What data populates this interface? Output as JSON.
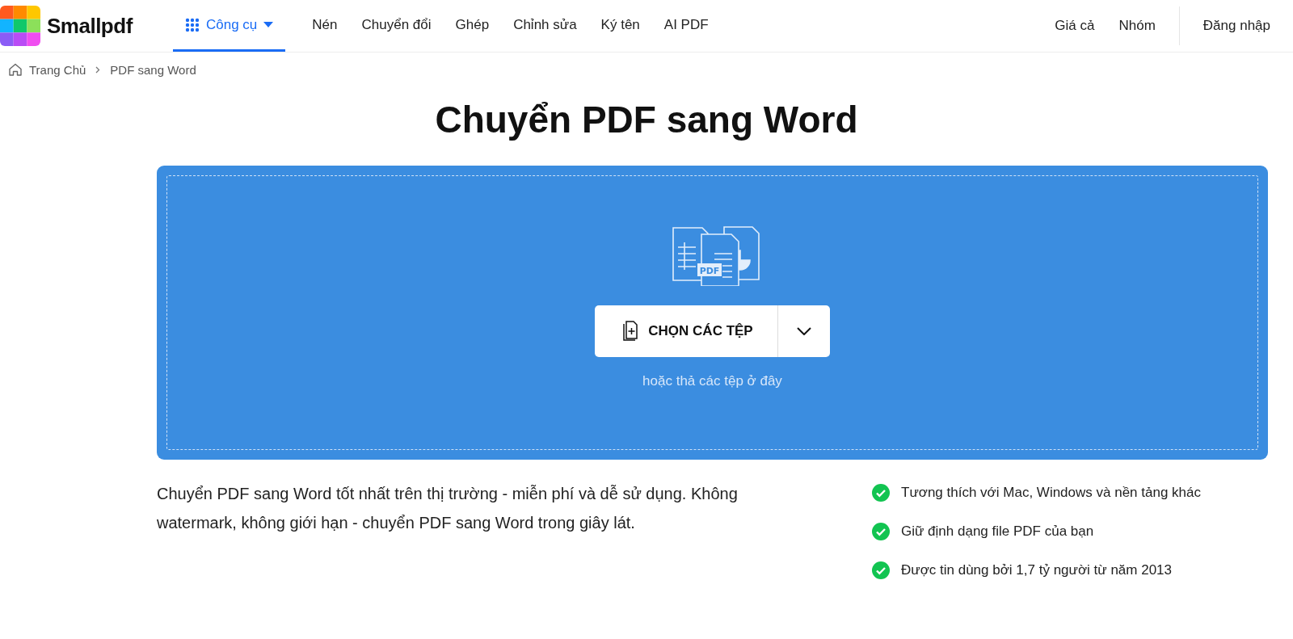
{
  "header": {
    "logo": "Smallpdf",
    "nav": [
      {
        "label": "Công cụ",
        "selected": true,
        "kind": "menu"
      },
      {
        "label": "Nén",
        "selected": false,
        "kind": "link"
      },
      {
        "label": "Chuyển đổi",
        "selected": false,
        "kind": "link"
      },
      {
        "label": "Ghép",
        "selected": false,
        "kind": "link"
      },
      {
        "label": "Chỉnh sửa",
        "selected": false,
        "kind": "link"
      },
      {
        "label": "Ký tên",
        "selected": false,
        "kind": "link"
      },
      {
        "label": "AI PDF",
        "selected": false,
        "kind": "link"
      }
    ],
    "right_links": [
      "Giá cả",
      "Nhóm"
    ],
    "login": "Đăng nhập"
  },
  "breadcrumb": [
    "Trang Chủ",
    "PDF sang Word"
  ],
  "title": "Chuyển PDF sang Word",
  "dropzone": {
    "illustration_label": "PDF",
    "button": "CHỌN CÁC TỆP",
    "hint": "hoặc thả các tệp ở đây"
  },
  "description": "Chuyển PDF sang Word tốt nhất trên thị trường - miễn phí và dễ sử dụng. Không watermark, không giới hạn - chuyển PDF sang Word trong giây lát.",
  "features": [
    "Tương thích với Mac, Windows và nền tảng khác",
    "Giữ định dạng file PDF của bạn",
    "Được tin dùng bởi 1,7 tỷ người từ năm 2013"
  ]
}
